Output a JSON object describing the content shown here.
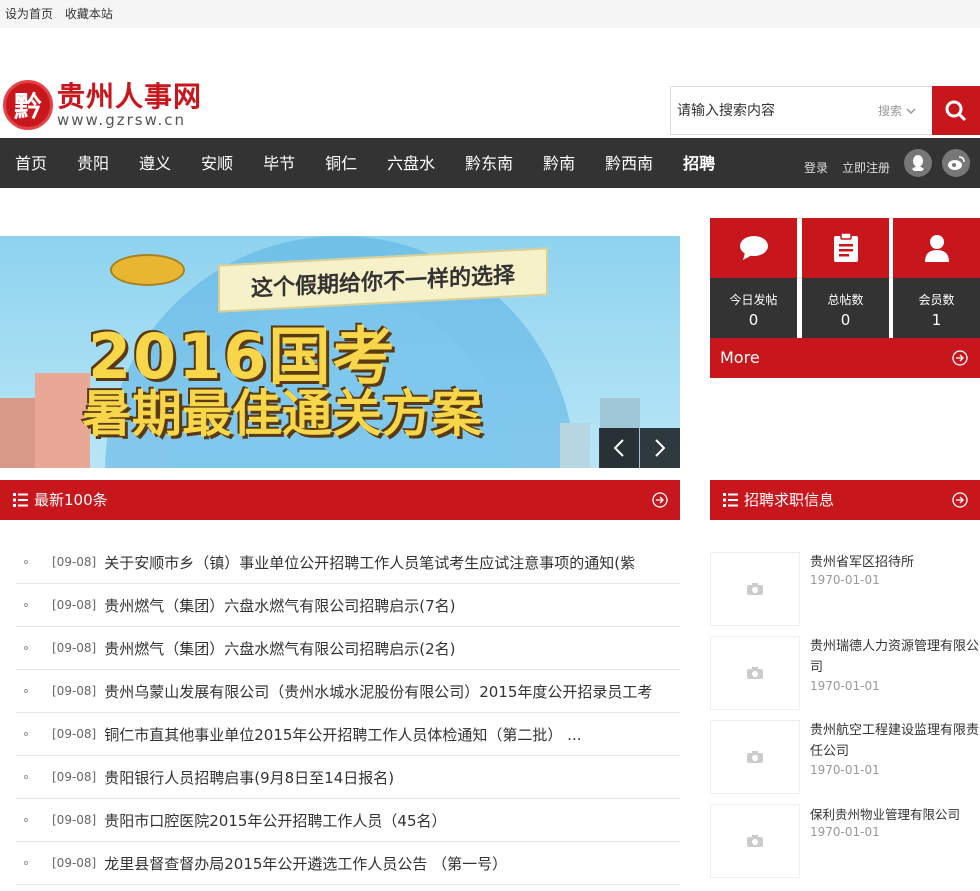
{
  "topbar": {
    "set_home": "设为首页",
    "bookmark": "收藏本站"
  },
  "logo": {
    "badge": "黔",
    "name": "贵州人事网",
    "domain": "www.gzrsw.cn"
  },
  "search": {
    "placeholder": "请输入搜索内容",
    "type_label": "搜索"
  },
  "nav": {
    "items": [
      "首页",
      "贵阳",
      "遵义",
      "安顺",
      "毕节",
      "铜仁",
      "六盘水",
      "黔东南",
      "黔南",
      "黔西南",
      "招聘"
    ],
    "login": "登录",
    "register": "立即注册"
  },
  "banner": {
    "flag_text": "这个假期给你不一样的选择",
    "headline": "2016国考",
    "subline": "暑期最佳通关方案"
  },
  "stats": [
    {
      "icon": "speech-bubble-icon",
      "label": "今日发帖",
      "value": "0"
    },
    {
      "icon": "clipboard-icon",
      "label": "总帖数",
      "value": "0"
    },
    {
      "icon": "user-icon",
      "label": "会员数",
      "value": "1"
    }
  ],
  "more_label": "More",
  "latest": {
    "title": "最新100条",
    "items": [
      {
        "date": "[09-08]",
        "title": "关于安顺市乡（镇）事业单位公开招聘工作人员笔试考生应试注意事项的通知(紫"
      },
      {
        "date": "[09-08]",
        "title": "贵州燃气（集团）六盘水燃气有限公司招聘启示(7名)"
      },
      {
        "date": "[09-08]",
        "title": "贵州燃气（集团）六盘水燃气有限公司招聘启示(2名)"
      },
      {
        "date": "[09-08]",
        "title": "贵州乌蒙山发展有限公司（贵州水城水泥股份有限公司）2015年度公开招录员工考"
      },
      {
        "date": "[09-08]",
        "title": "铜仁市直其他事业单位2015年公开招聘工作人员体检通知（第二批） ..."
      },
      {
        "date": "[09-08]",
        "title": "贵阳银行人员招聘启事(9月8日至14日报名)"
      },
      {
        "date": "[09-08]",
        "title": "贵阳市口腔医院2015年公开招聘工作人员（45名）"
      },
      {
        "date": "[09-08]",
        "title": "龙里县督查督办局2015年公开遴选工作人员公告 （第一号）"
      }
    ]
  },
  "jobs": {
    "title": "招聘求职信息",
    "items": [
      {
        "name": "贵州省军区招待所",
        "date": "1970-01-01"
      },
      {
        "name": "贵州瑞德人力资源管理有限公司",
        "date": "1970-01-01"
      },
      {
        "name": "贵州航空工程建设监理有限责任公司",
        "date": "1970-01-01"
      },
      {
        "name": "保利贵州物业管理有限公司",
        "date": "1970-01-01"
      }
    ]
  },
  "colors": {
    "brand": "#c8161d",
    "nav_bg": "#333333"
  }
}
